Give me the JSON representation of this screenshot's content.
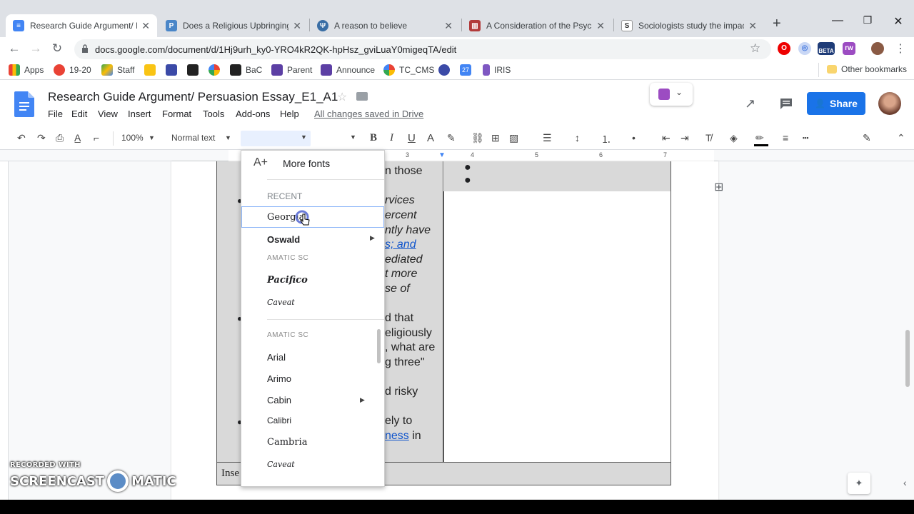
{
  "tabs": [
    {
      "title": "Research Guide Argument/ Pe",
      "active": true
    },
    {
      "title": "Does a Religious Upbringing P",
      "active": false
    },
    {
      "title": "A reason to believe",
      "active": false
    },
    {
      "title": "A Consideration of the Psychol",
      "active": false
    },
    {
      "title": "Sociologists study the impact",
      "active": false
    }
  ],
  "new_tab_label": "+",
  "address_bar": {
    "url": "docs.google.com/document/d/1Hj9urh_ky0-YRO4kR2QK-hpHsz_gviLuaY0migeqTA/edit"
  },
  "extensions": {
    "beta_badge": "BETA"
  },
  "bookmarks": {
    "items": [
      "Apps",
      "19-20",
      "Staff",
      "BaC",
      "Parent",
      "Announce",
      "TC_CMS",
      "27",
      "IRIS"
    ],
    "other": "Other bookmarks"
  },
  "docs": {
    "title": "Research Guide Argument/ Persuasion Essay_E1_A1",
    "menus": [
      "File",
      "Edit",
      "View",
      "Insert",
      "Format",
      "Tools",
      "Add-ons",
      "Help"
    ],
    "save_status": "All changes saved in Drive",
    "share_label": "Share"
  },
  "format_toolbar": {
    "zoom": "100%",
    "style": "Normal text",
    "font": "",
    "size": ""
  },
  "ruler_marks": [
    "3",
    "4",
    "5",
    "6",
    "7"
  ],
  "font_menu": {
    "more_fonts": "More fonts",
    "recent_header": "RECENT",
    "recent": [
      "Georgia",
      "Oswald",
      "AMATIC SC",
      "Pacifico",
      "Caveat"
    ],
    "all": [
      "AMATIC SC",
      "Arial",
      "Arimo",
      "Cabin",
      "Calibri",
      "Cambria",
      "Caveat"
    ]
  },
  "document_text": {
    "lines_left": [
      {
        "text": "n those",
        "italic": false
      },
      {
        "text": "rvices",
        "italic": true
      },
      {
        "text": "ercent",
        "italic": true
      },
      {
        "text": "ntly have",
        "italic": true
      },
      {
        "text": "s; and",
        "italic": true
      },
      {
        "text": "ediated",
        "italic": true
      },
      {
        "text": "t more",
        "italic": true
      },
      {
        "text": "se of",
        "italic": true
      },
      {
        "text": "d that",
        "italic": false
      },
      {
        "text": "eligiously",
        "italic": false
      },
      {
        "text": ", what are",
        "italic": false
      },
      {
        "text": "g three\"",
        "italic": false
      },
      {
        "text": "d risky",
        "italic": false
      },
      {
        "text": "ely to",
        "italic": false
      },
      {
        "text": "ness",
        "italic": false
      },
      {
        "text": " in",
        "italic": false
      }
    ],
    "bottom_cell": "Inse"
  },
  "watermark": {
    "line1": "RECORDED WITH",
    "line2a": "SCREENCAST",
    "line2b": "MATIC"
  },
  "colors": {
    "accent": "#1a73e8",
    "tab_strip": "#dee1e6",
    "table_shade": "#d9d9d9"
  }
}
